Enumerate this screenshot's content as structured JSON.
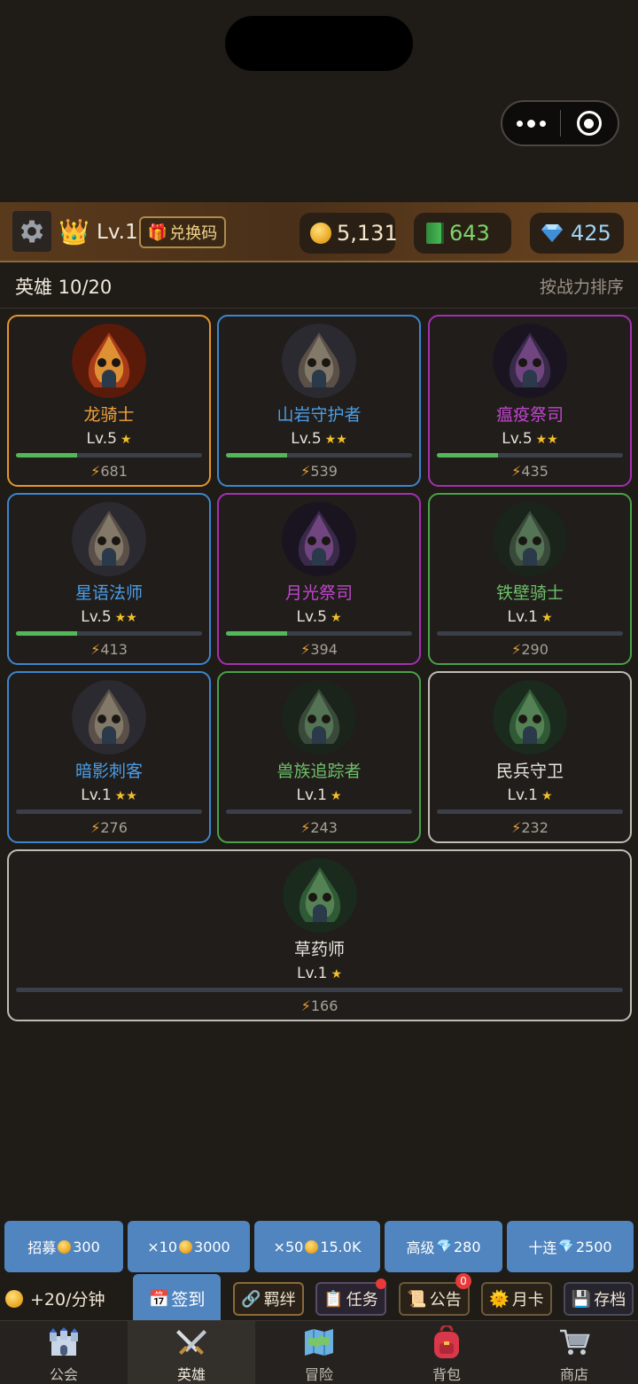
{
  "topbar": {
    "level": "Lv.1",
    "redeem_label": "兑换码",
    "coins": "5,131",
    "books": "643",
    "gems": "425"
  },
  "hero_header": {
    "count": "英雄 10/20",
    "sort_label": "按战力排序"
  },
  "heroes": [
    {
      "name": "龙骑士",
      "level": "Lv.5",
      "stars": "★",
      "power": "681",
      "rarity": "orange",
      "exp_progress": 0.33
    },
    {
      "name": "山岩守护者",
      "level": "Lv.5",
      "stars": "★★",
      "power": "539",
      "rarity": "blue",
      "exp_progress": 0.33
    },
    {
      "name": "瘟疫祭司",
      "level": "Lv.5",
      "stars": "★★",
      "power": "435",
      "rarity": "purple",
      "exp_progress": 0.33
    },
    {
      "name": "星语法师",
      "level": "Lv.5",
      "stars": "★★",
      "power": "413",
      "rarity": "blue",
      "exp_progress": 0.33
    },
    {
      "name": "月光祭司",
      "level": "Lv.5",
      "stars": "★",
      "power": "394",
      "rarity": "purple",
      "exp_progress": 0.33
    },
    {
      "name": "铁壁骑士",
      "level": "Lv.1",
      "stars": "★",
      "power": "290",
      "rarity": "green",
      "exp_progress": 0
    },
    {
      "name": "暗影刺客",
      "level": "Lv.1",
      "stars": "★★",
      "power": "276",
      "rarity": "blue",
      "exp_progress": 0
    },
    {
      "name": "兽族追踪者",
      "level": "Lv.1",
      "stars": "★",
      "power": "243",
      "rarity": "green",
      "exp_progress": 0
    },
    {
      "name": "民兵守卫",
      "level": "Lv.1",
      "stars": "★",
      "power": "232",
      "rarity": "white",
      "exp_progress": 0
    },
    {
      "name": "草药师",
      "level": "Lv.1",
      "stars": "★",
      "power": "166",
      "rarity": "white",
      "exp_progress": 0
    }
  ],
  "recruit": [
    {
      "prefix": "招募",
      "currency": "coin",
      "cost": "300"
    },
    {
      "prefix": "×10",
      "currency": "coin",
      "cost": "3000"
    },
    {
      "prefix": "×50",
      "currency": "coin",
      "cost": "15.0K"
    },
    {
      "prefix": "高级",
      "currency": "gem",
      "cost": "280"
    },
    {
      "prefix": "十连",
      "currency": "gem",
      "cost": "2500"
    }
  ],
  "actions": {
    "income": "+20/分钟",
    "signin": "签到",
    "bond": "羁绊",
    "task": "任务",
    "notice": "公告",
    "notice_badge": "0",
    "month_card": "月卡",
    "save": "存档"
  },
  "nav": [
    {
      "label": "公会",
      "icon": "castle-icon"
    },
    {
      "label": "英雄",
      "icon": "crossed-swords-icon",
      "active": true
    },
    {
      "label": "冒险",
      "icon": "map-icon"
    },
    {
      "label": "背包",
      "icon": "backpack-icon"
    },
    {
      "label": "商店",
      "icon": "cart-icon"
    }
  ],
  "colors": {
    "orange": "#e6962a",
    "blue": "#3c86d0",
    "purple": "#a52fb3",
    "green": "#4aa14a",
    "white": "#bfbcb6",
    "button_blue": "#5185c0"
  }
}
